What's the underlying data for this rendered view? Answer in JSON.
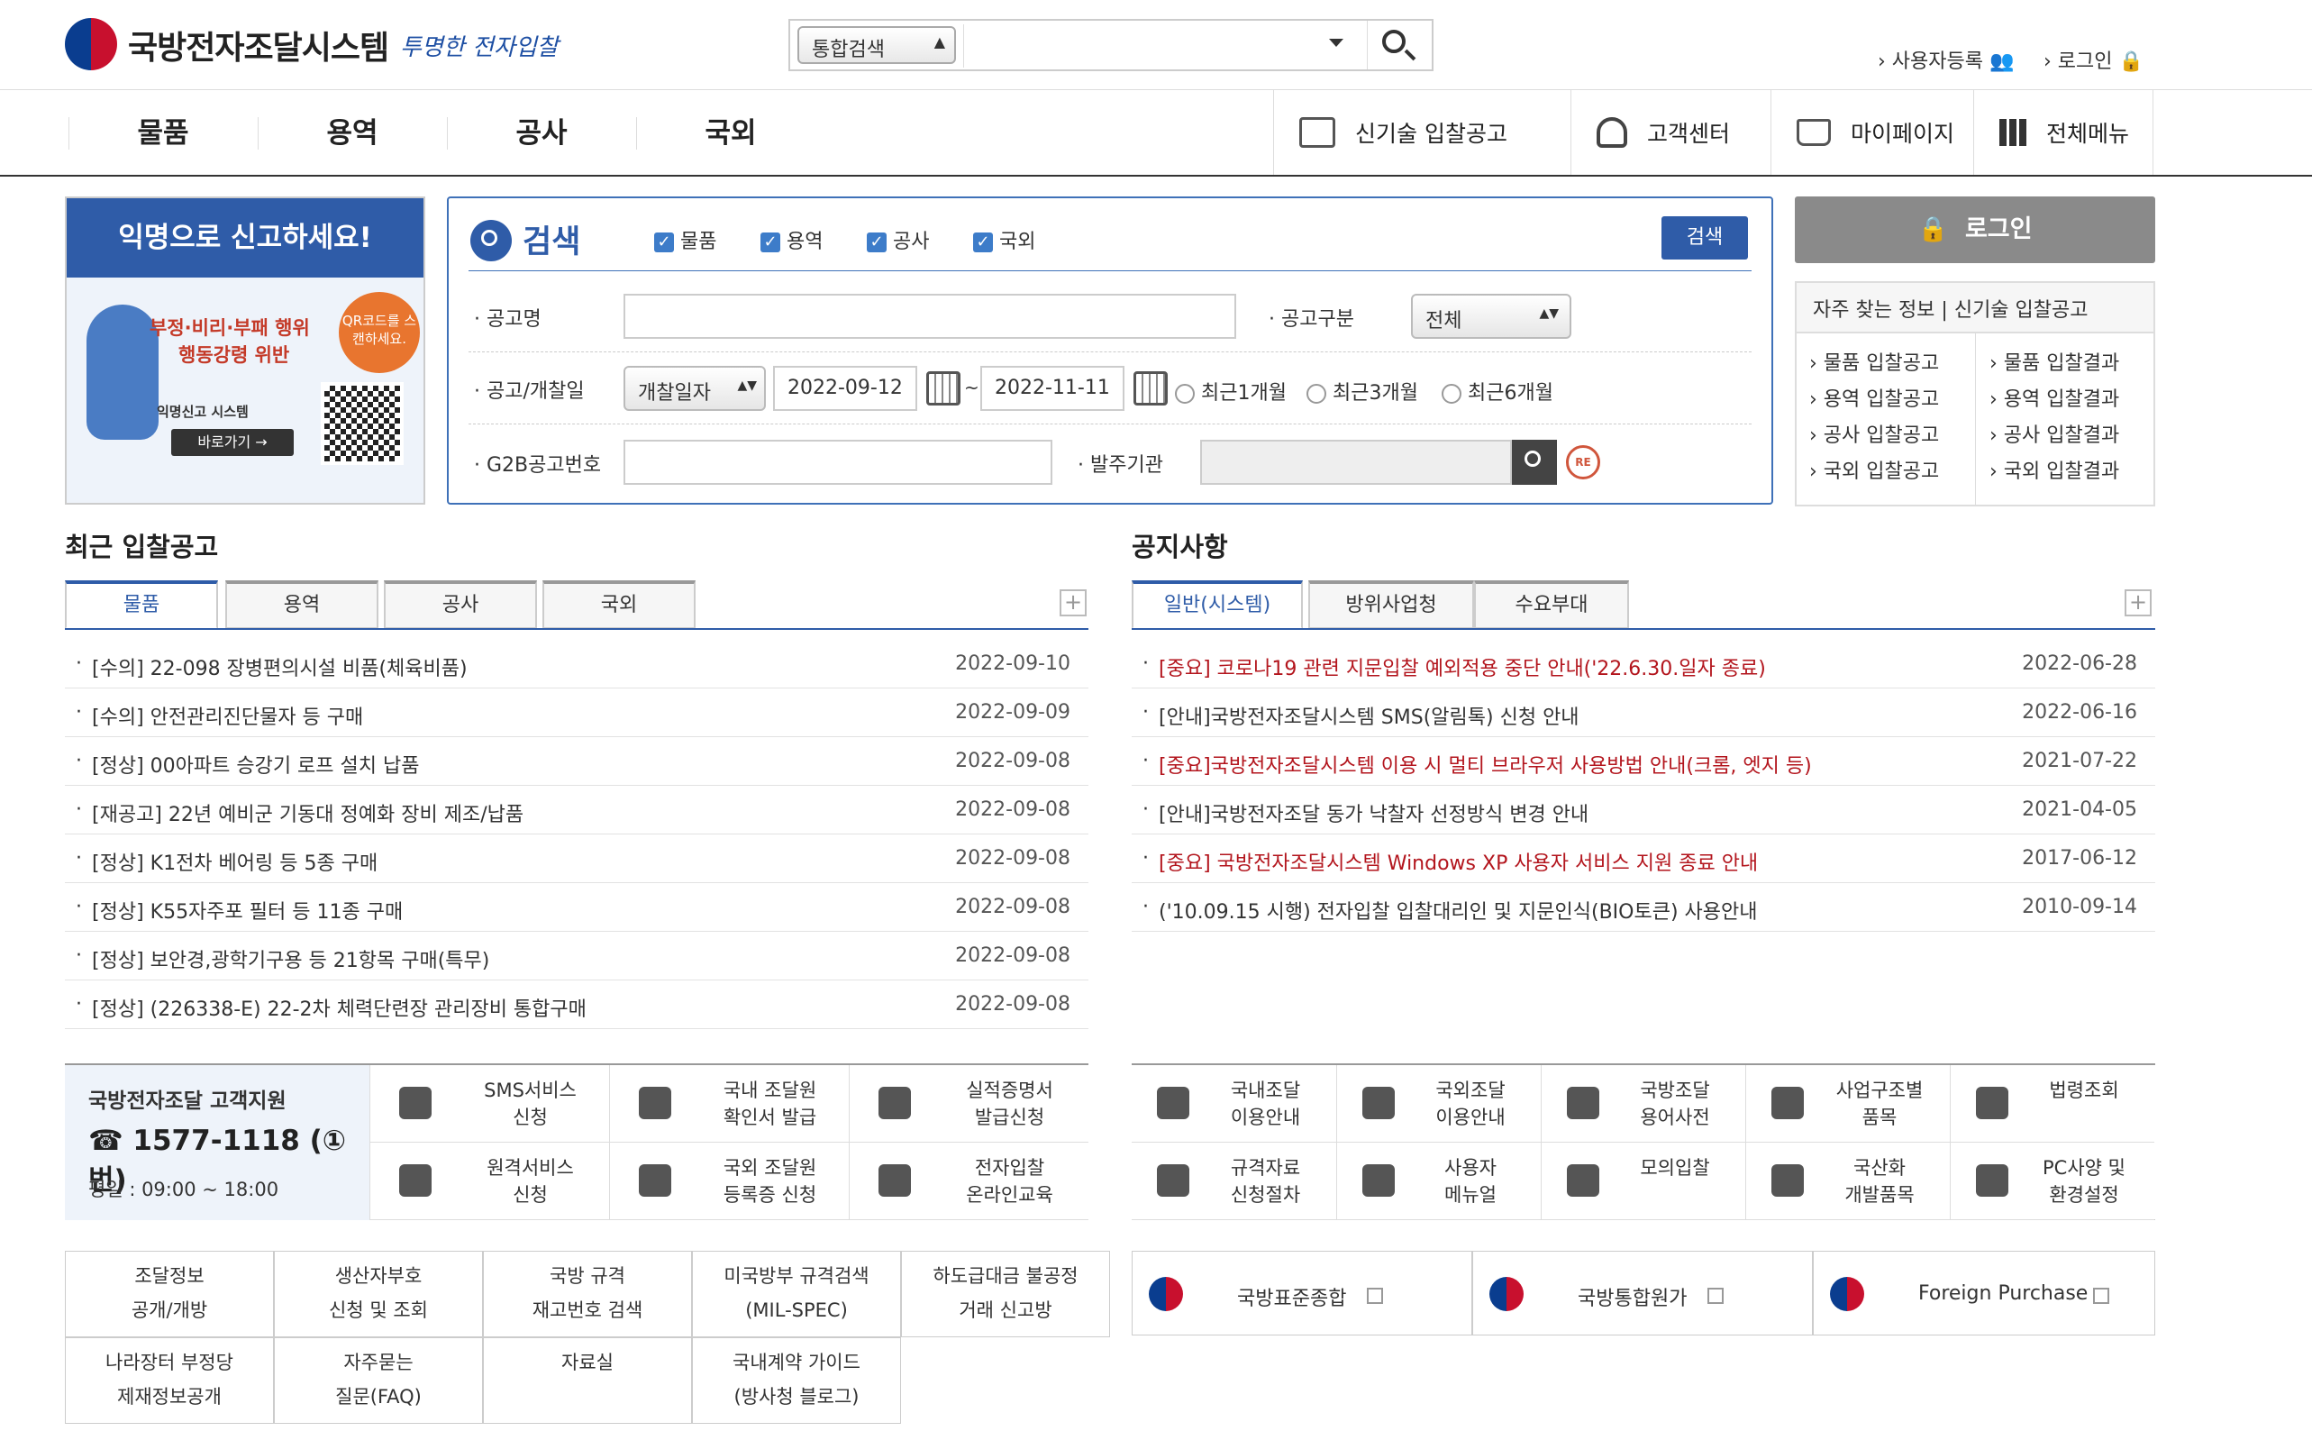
{
  "header": {
    "logo_text": "국방전자조달시스템",
    "slogan": "투명한 전자입찰",
    "search_select": "통합검색",
    "search_value": "",
    "util_register": "사용자등록",
    "util_login": "로그인"
  },
  "gnb": {
    "items": [
      "물품",
      "용역",
      "공사",
      "국외"
    ],
    "right": [
      "신기술 입찰공고",
      "고객센터",
      "마이페이지",
      "전체메뉴"
    ]
  },
  "banner": {
    "title": "익명으로 신고하세요!",
    "line1": "부정·비리·부패 행위",
    "line2": "행동강령 위반",
    "qr_hint": "QR코드를 스캔하세요.",
    "system": "익명신고 시스템",
    "go": "바로가기 →"
  },
  "search": {
    "title": "검색",
    "checks": [
      "물품",
      "용역",
      "공사",
      "국외"
    ],
    "button": "검색",
    "label_name": "공고명",
    "label_type": "공고구분",
    "type_value": "전체",
    "label_date": "공고/개찰일",
    "date_type": "개찰일자",
    "date_from": "2022-09-12",
    "tilde": "~",
    "date_to": "2022-11-11",
    "radios": [
      "최근1개월",
      "최근3개월",
      "최근6개월"
    ],
    "label_g2b": "G2B공고번호",
    "label_org": "발주기관",
    "reset_label": "RE"
  },
  "side": {
    "login": "로그인",
    "quick_title": "자주 찾는 정보 | 신기술 입찰공고",
    "left": [
      "물품 입찰공고",
      "용역 입찰공고",
      "공사 입찰공고",
      "국외 입찰공고"
    ],
    "right": [
      "물품 입찰결과",
      "용역 입찰결과",
      "공사 입찰결과",
      "국외 입찰결과"
    ]
  },
  "recent": {
    "title": "최근 입찰공고",
    "tabs": [
      "물품",
      "용역",
      "공사",
      "국외"
    ],
    "rows": [
      {
        "title": "[수의] 22-098 장병편의시설 비품(체육비품)",
        "date": "2022-09-10"
      },
      {
        "title": "[수의] 안전관리진단물자 등 구매",
        "date": "2022-09-09"
      },
      {
        "title": "[정상] 00아파트 승강기 로프 설치 납품",
        "date": "2022-09-08"
      },
      {
        "title": "[재공고] 22년 예비군 기동대 정예화 장비 제조/납품",
        "date": "2022-09-08"
      },
      {
        "title": "[정상] K1전차 베어링 등 5종 구매",
        "date": "2022-09-08"
      },
      {
        "title": "[정상] K55자주포 필터 등 11종 구매",
        "date": "2022-09-08"
      },
      {
        "title": "[정상] 보안경,광학기구용 등 21항목 구매(특무)",
        "date": "2022-09-08"
      },
      {
        "title": "[정상] (226338-E) 22-2차 체력단련장 관리장비 통합구매",
        "date": "2022-09-08"
      }
    ]
  },
  "notice": {
    "title": "공지사항",
    "tabs": [
      "일반(시스템)",
      "방위사업청",
      "수요부대"
    ],
    "rows": [
      {
        "title": "[중요] 코로나19 관련 지문입찰 예외적용 중단 안내('22.6.30.일자 종료)",
        "date": "2022-06-28",
        "red": true
      },
      {
        "title": "[안내]국방전자조달시스템 SMS(알림톡) 신청 안내",
        "date": "2022-06-16",
        "red": false
      },
      {
        "title": "[중요]국방전자조달시스템 이용 시 멀티 브라우저 사용방법 안내(크롬, 엣지 등)",
        "date": "2021-07-22",
        "red": true
      },
      {
        "title": "[안내]국방전자조달 동가 낙찰자 선정방식 변경 안내",
        "date": "2021-04-05",
        "red": false
      },
      {
        "title": "[중요] 국방전자조달시스템 Windows XP 사용자 서비스 지원 종료 안내",
        "date": "2017-06-12",
        "red": true
      },
      {
        "title": "('10.09.15 시행) 전자입찰 입찰대리인 및 지문인식(BIO토큰) 사용안내",
        "date": "2010-09-14",
        "red": false
      }
    ]
  },
  "support": {
    "title": "국방전자조달 고객지원",
    "phone": "1577-1118 (①번)",
    "hours": "평일 : 09:00 ~ 18:00"
  },
  "services_left": [
    [
      "SMS서비스",
      "신청"
    ],
    [
      "국내 조달원",
      "확인서 발급"
    ],
    [
      "실적증명서",
      "발급신청"
    ],
    [
      "원격서비스",
      "신청"
    ],
    [
      "국외 조달원",
      "등록증 신청"
    ],
    [
      "전자입찰",
      "온라인교육"
    ]
  ],
  "services_right": [
    [
      "국내조달",
      "이용안내"
    ],
    [
      "국외조달",
      "이용안내"
    ],
    [
      "국방조달",
      "용어사전"
    ],
    [
      "사업구조별",
      "품목"
    ],
    [
      "법령조회",
      ""
    ],
    [
      "규격자료",
      "신청절차"
    ],
    [
      "사용자",
      "메뉴얼"
    ],
    [
      "모의입찰",
      ""
    ],
    [
      "국산화",
      "개발품목"
    ],
    [
      "PC사양 및",
      "환경설정"
    ]
  ],
  "bottom_links": [
    [
      "조달정보",
      "공개/개방"
    ],
    [
      "생산자부호",
      "신청 및 조회"
    ],
    [
      "국방 규격",
      "재고번호 검색"
    ],
    [
      "미국방부 규격검색",
      "(MIL-SPEC)"
    ],
    [
      "하도급대금 불공정",
      "거래 신고방"
    ],
    [
      "나라장터 부정당",
      "제재정보공개"
    ],
    [
      "자주묻는",
      "질문(FAQ)"
    ],
    [
      "자료실",
      ""
    ],
    [
      "국내계약 가이드",
      "(방사청 블로그)"
    ]
  ],
  "family": [
    "국방표준종합",
    "국방통합원가",
    "Foreign Purchase"
  ]
}
